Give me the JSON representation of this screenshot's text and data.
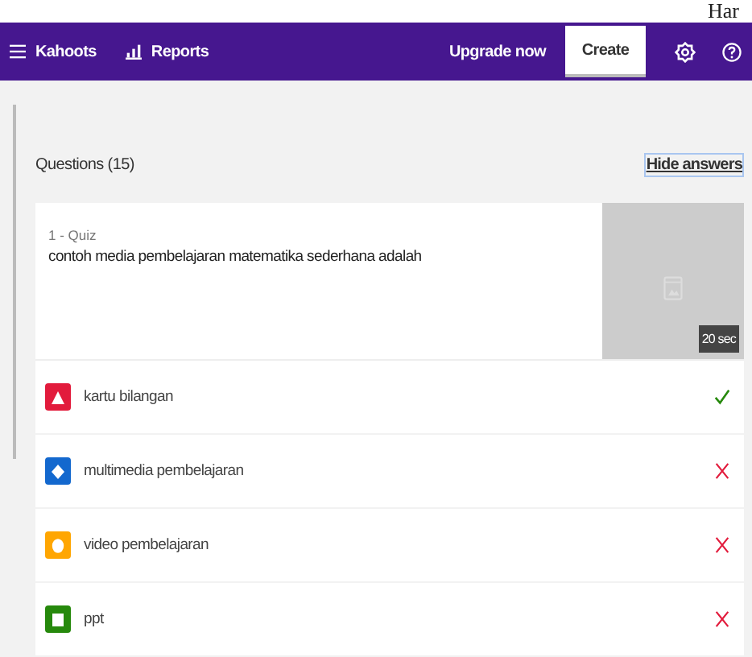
{
  "page_heading": "Har",
  "nav": {
    "items": [
      {
        "label": "Kahoots",
        "kind": "list"
      },
      {
        "label": "Reports",
        "kind": "chart"
      }
    ],
    "upgrade": "Upgrade now",
    "create": "Create"
  },
  "questions_header": {
    "title": "Questions (15)",
    "toggle": "Hide answers"
  },
  "question": {
    "type": "1 - Quiz",
    "text": "contoh media pembelajaran matematika sederhana adalah",
    "time": "20 sec"
  },
  "answers": [
    {
      "text": "kartu bilangan",
      "kind": "triangle",
      "color": "#e21b3c",
      "correct": true
    },
    {
      "text": "multimedia pembelajaran",
      "kind": "diamond",
      "color": "#1368ce",
      "correct": false
    },
    {
      "text": "video pembelajaran",
      "kind": "circle",
      "color": "#ffa602",
      "correct": false
    },
    {
      "text": "ppt",
      "kind": "square",
      "color": "#26890c",
      "correct": false
    }
  ]
}
